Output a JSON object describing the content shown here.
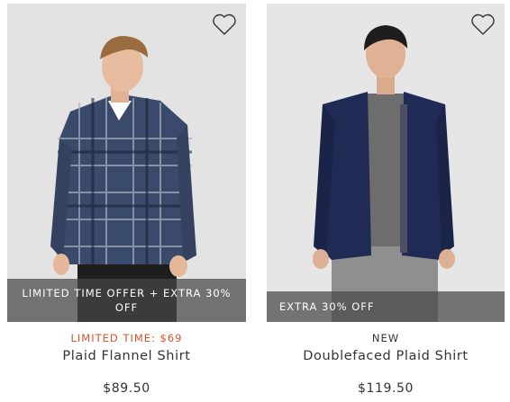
{
  "products": [
    {
      "promo": "LIMITED TIME OFFER + EXTRA 30% OFF",
      "flag": "LIMITED TIME: $69",
      "name": "Plaid Flannel Shirt",
      "price": "$89.50",
      "wishlist_icon": "heart-outline-icon",
      "shirt_color": "#3a4a6a"
    },
    {
      "promo": "EXTRA 30% OFF",
      "flag": "NEW",
      "name": "Doublefaced Plaid Shirt",
      "price": "$119.50",
      "wishlist_icon": "heart-outline-icon",
      "shirt_color": "#1f2b55"
    }
  ],
  "colors": {
    "sale_flag": "#d9532c",
    "promo_overlay": "#464646",
    "photo_background": "#e4e4e4"
  }
}
